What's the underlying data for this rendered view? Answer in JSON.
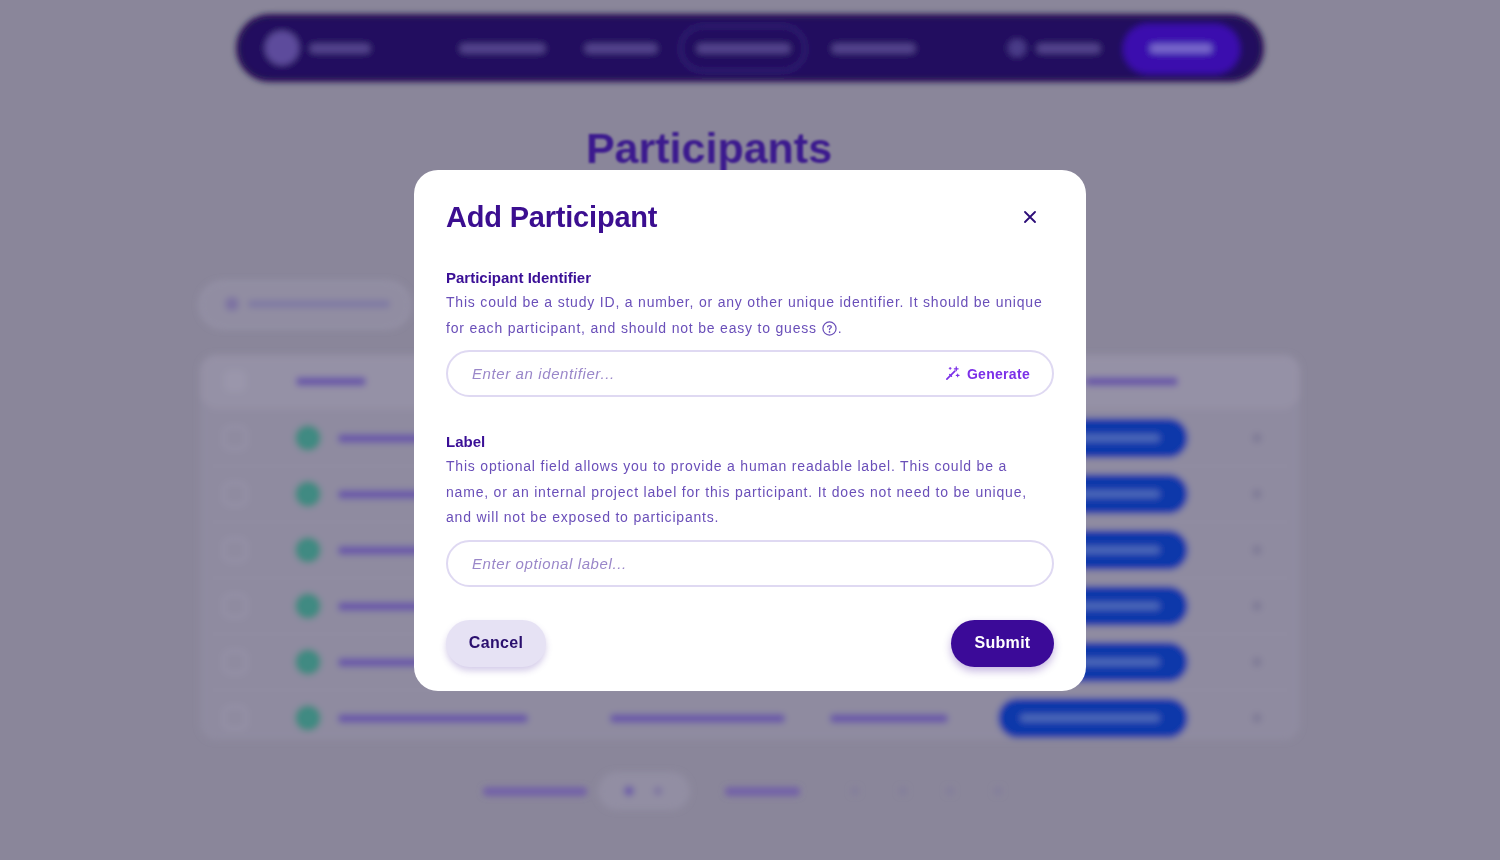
{
  "page": {
    "title": "Participants"
  },
  "dialog": {
    "title": "Add Participant",
    "fields": [
      {
        "label": "Participant Identifier",
        "description": "This could be a study ID, a number, or any other unique identifier. It should be unique for each participant, and should not be easy to guess",
        "help_icon": true,
        "description_end": ".",
        "placeholder": "Enter an identifier...",
        "action": "Generate"
      },
      {
        "label": "Label",
        "description": "This optional field allows you to provide a human readable label. This could be a name, or an internal project label for this participant. It does not need to be unique, and will not be exposed to participants.",
        "help_icon": false,
        "placeholder": "Enter optional label..."
      }
    ],
    "buttons": [
      {
        "kind": "secondary",
        "label": "Cancel"
      },
      {
        "kind": "primary",
        "label": "Submit"
      }
    ]
  }
}
